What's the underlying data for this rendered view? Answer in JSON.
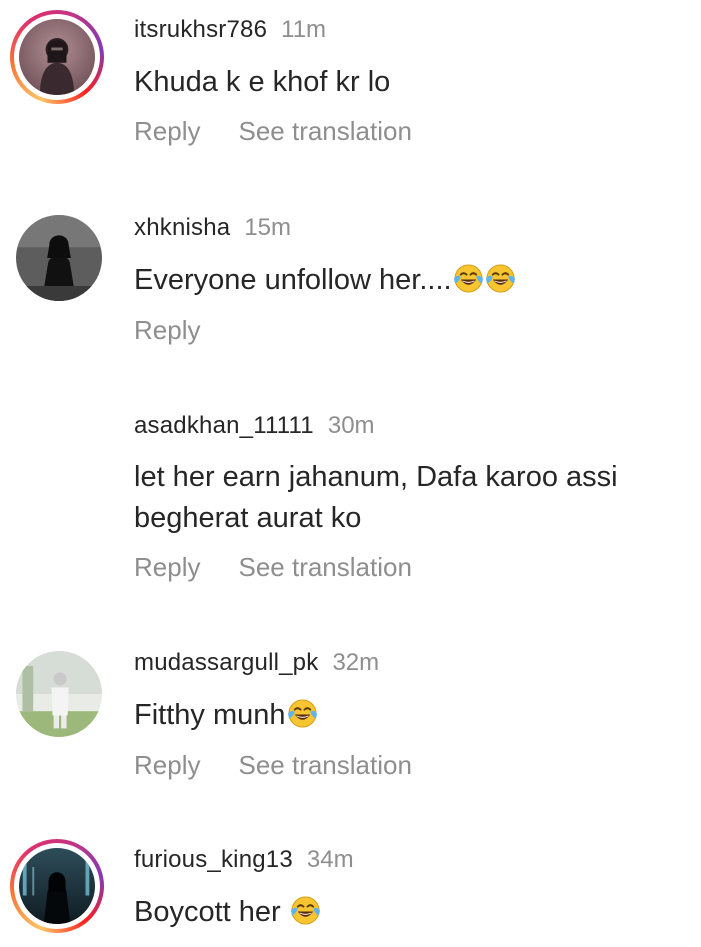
{
  "comments": [
    {
      "username": "itsrukhsr786",
      "time": "11m",
      "text": "Khuda k e khof kr lo",
      "emoji_count": 0,
      "reply_label": "Reply",
      "translate_label": "See translation",
      "avatar": "avatar-photo-woman",
      "story_ring": true
    },
    {
      "username": "xhknisha",
      "time": "15m",
      "text": "Everyone unfollow her....",
      "emoji_count": 2,
      "reply_label": "Reply",
      "avatar": "avatar-photo-dark-figure",
      "story_ring": false
    },
    {
      "username": "asadkhan_11111",
      "time": "30m",
      "text": "let her earn jahanum, Dafa karoo assi begherat aurat ko",
      "emoji_count": 0,
      "reply_label": "Reply",
      "translate_label": "See translation",
      "avatar": "none",
      "story_ring": false
    },
    {
      "username": "mudassargull_pk",
      "time": "32m",
      "text": "Fitthy munh",
      "emoji_count": 1,
      "reply_label": "Reply",
      "translate_label": "See translation",
      "avatar": "avatar-photo-outdoor",
      "story_ring": false
    },
    {
      "username": "furious_king13",
      "time": "34m",
      "text": "Boycott her ",
      "emoji_count": 1,
      "avatar": "avatar-photo-hooded-figure",
      "story_ring": true
    }
  ],
  "emoji": "tears-of-joy",
  "colors": {
    "primary_text": "#262626",
    "secondary_text": "#8e8e8e",
    "background": "#ffffff"
  }
}
